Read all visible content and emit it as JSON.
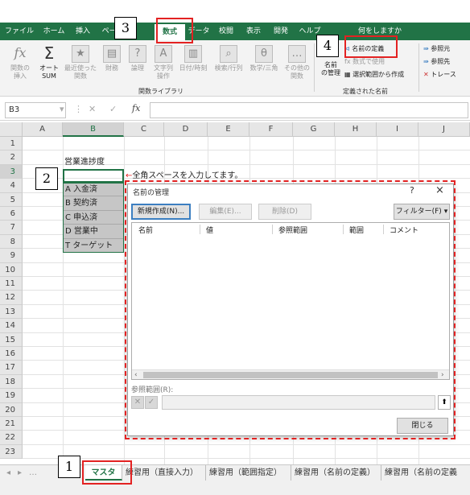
{
  "ribbon_tabs": [
    "ファイル",
    "ホーム",
    "挿入",
    "ページ",
    "数式",
    "データ",
    "校閲",
    "表示",
    "開発",
    "ヘルプ",
    "何をしますか"
  ],
  "active_tab": "数式",
  "ribbon": {
    "function_library": {
      "label": "関数ライブラリ",
      "items": [
        {
          "icon": "fx-icon",
          "glyph": "fx",
          "label": "関数の\n挿入"
        },
        {
          "icon": "autosum-icon",
          "glyph": "Σ",
          "label": "オート\nSUM"
        },
        {
          "icon": "recent-star-icon",
          "glyph": "★",
          "label": "最近使った\n関数"
        },
        {
          "icon": "finance-icon",
          "glyph": "▤",
          "label": "財務"
        },
        {
          "icon": "logical-icon",
          "glyph": "?",
          "label": "論理"
        },
        {
          "icon": "text-icon",
          "glyph": "A",
          "label": "文字列\n操作"
        },
        {
          "icon": "datetime-icon",
          "glyph": "▥",
          "label": "日付/時刻"
        },
        {
          "icon": "lookup-icon",
          "glyph": "⌕",
          "label": "検索/行列"
        },
        {
          "icon": "math-icon",
          "glyph": "θ",
          "label": "数学/三角"
        },
        {
          "icon": "more-icon",
          "glyph": "…",
          "label": "その他の\n関数"
        }
      ]
    },
    "defined_names": {
      "label": "定義された名前",
      "name_manager": "名前\nの管理",
      "define_name": "名前の定義",
      "use_in_formula": "数式で使用",
      "create_from_selection": "選択範囲から作成"
    },
    "auditing": {
      "trace_precedents": "参照元",
      "trace_dependents": "参照先",
      "remove_arrows": "トレース"
    }
  },
  "formula_bar": {
    "name_box": "B3",
    "fx": "fx"
  },
  "columns": [
    "A",
    "B",
    "C",
    "D",
    "E",
    "F",
    "G",
    "H",
    "I",
    "J"
  ],
  "selected_column": "B",
  "rows": [
    "1",
    "2",
    "3",
    "4",
    "5",
    "6",
    "7",
    "8",
    "9",
    "10",
    "11",
    "12",
    "13",
    "14",
    "15",
    "16",
    "17",
    "18",
    "19",
    "20",
    "21",
    "22",
    "23"
  ],
  "cells": {
    "B2": "営業進捗度",
    "B4": "A 入金済",
    "B5": "B 契約済",
    "B6": "C 申込済",
    "B7": "D 営業中",
    "B8": "T ターゲット"
  },
  "note": {
    "arrow": "←",
    "text": "全角スペースを入力してます。"
  },
  "sheet_tabs": [
    "マスタ",
    "練習用（直接入力）",
    "練習用（範囲指定）",
    "練習用（名前の定義）",
    "練習用（名前の定義"
  ],
  "active_sheet": "マスタ",
  "dialog": {
    "title": "名前の管理",
    "help": "?",
    "close": "×",
    "new_button": "新規作成(N)...",
    "edit_button": "編集(E)...",
    "delete_button": "削除(D)",
    "filter_button": "フィルター(F)",
    "columns": [
      "名前",
      "値",
      "参照範囲",
      "範囲",
      "コメント"
    ],
    "ref_label": "参照範囲(R):",
    "close_button": "閉じる"
  },
  "annotations": [
    "1",
    "2",
    "3",
    "4"
  ],
  "colors": {
    "excel_green": "#217346",
    "annotation_red": "#e32222"
  }
}
